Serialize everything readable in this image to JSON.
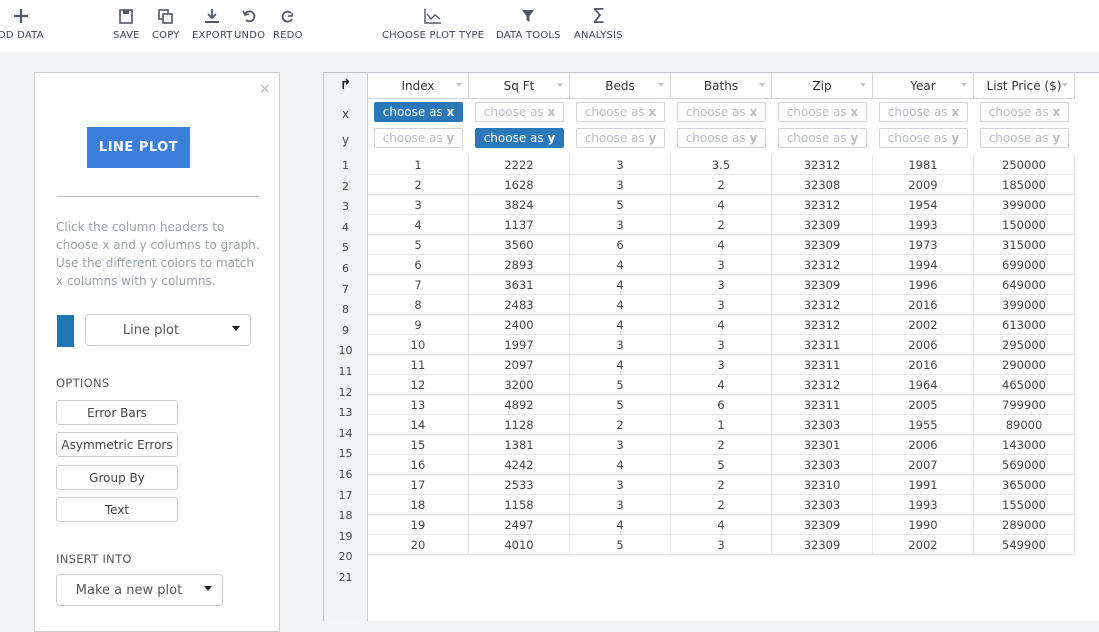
{
  "toolbar": {
    "items": [
      {
        "name": "add-data",
        "label": "DD DATA",
        "icon": "plus-icon"
      },
      {
        "name": "save",
        "label": "SAVE",
        "icon": "save-icon"
      },
      {
        "name": "copy",
        "label": "COPY",
        "icon": "copy-icon"
      },
      {
        "name": "export",
        "label": "EXPORT",
        "icon": "export-icon"
      },
      {
        "name": "undo",
        "label": "UNDO",
        "icon": "undo-icon"
      },
      {
        "name": "redo",
        "label": "REDO",
        "icon": "redo-icon"
      },
      {
        "name": "choose-plot-type",
        "label": "CHOOSE PLOT TYPE",
        "icon": "line-chart-icon"
      },
      {
        "name": "data-tools",
        "label": "DATA TOOLS",
        "icon": "filter-icon"
      },
      {
        "name": "analysis",
        "label": "ANALYSIS",
        "icon": "sigma-icon"
      }
    ]
  },
  "sidebar": {
    "close": "×",
    "plot_button": "LINE PLOT",
    "help_text": "Click the column headers to choose x and y columns to graph. Use the different colors to match x columns with y columns.",
    "swatch_color": "#1f77b4",
    "plot_type_select": "Line plot",
    "options_title": "OPTIONS",
    "options": [
      "Error Bars",
      "Asymmetric Errors",
      "Group By",
      "Text"
    ],
    "insert_title": "INSERT INTO",
    "insert_select": "Make a new plot"
  },
  "grid": {
    "corner_icon": "↱",
    "x_label": "x",
    "y_label": "y",
    "columns": [
      "Index",
      "Sq Ft",
      "Beds",
      "Baths",
      "Zip",
      "Year",
      "List Price ($)"
    ],
    "choose_prefix": "choose as ",
    "x_choice": "x",
    "y_choice": "y",
    "selected_x_column": "Index",
    "selected_y_column": "Sq Ft",
    "accent_color": "#2a78ba",
    "row_numbers": [
      "1",
      "2",
      "3",
      "4",
      "5",
      "6",
      "7",
      "8",
      "9",
      "10",
      "11",
      "12",
      "13",
      "14",
      "15",
      "16",
      "17",
      "18",
      "19",
      "20",
      "21"
    ],
    "rows": [
      [
        "1",
        "2222",
        "3",
        "3.5",
        "32312",
        "1981",
        "250000"
      ],
      [
        "2",
        "1628",
        "3",
        "2",
        "32308",
        "2009",
        "185000"
      ],
      [
        "3",
        "3824",
        "5",
        "4",
        "32312",
        "1954",
        "399000"
      ],
      [
        "4",
        "1137",
        "3",
        "2",
        "32309",
        "1993",
        "150000"
      ],
      [
        "5",
        "3560",
        "6",
        "4",
        "32309",
        "1973",
        "315000"
      ],
      [
        "6",
        "2893",
        "4",
        "3",
        "32312",
        "1994",
        "699000"
      ],
      [
        "7",
        "3631",
        "4",
        "3",
        "32309",
        "1996",
        "649000"
      ],
      [
        "8",
        "2483",
        "4",
        "3",
        "32312",
        "2016",
        "399000"
      ],
      [
        "9",
        "2400",
        "4",
        "4",
        "32312",
        "2002",
        "613000"
      ],
      [
        "10",
        "1997",
        "3",
        "3",
        "32311",
        "2006",
        "295000"
      ],
      [
        "11",
        "2097",
        "4",
        "3",
        "32311",
        "2016",
        "290000"
      ],
      [
        "12",
        "3200",
        "5",
        "4",
        "32312",
        "1964",
        "465000"
      ],
      [
        "13",
        "4892",
        "5",
        "6",
        "32311",
        "2005",
        "799900"
      ],
      [
        "14",
        "1128",
        "2",
        "1",
        "32303",
        "1955",
        "89000"
      ],
      [
        "15",
        "1381",
        "3",
        "2",
        "32301",
        "2006",
        "143000"
      ],
      [
        "16",
        "4242",
        "4",
        "5",
        "32303",
        "2007",
        "569000"
      ],
      [
        "17",
        "2533",
        "3",
        "2",
        "32310",
        "1991",
        "365000"
      ],
      [
        "18",
        "1158",
        "3",
        "2",
        "32303",
        "1993",
        "155000"
      ],
      [
        "19",
        "2497",
        "4",
        "4",
        "32309",
        "1990",
        "289000"
      ],
      [
        "20",
        "4010",
        "5",
        "3",
        "32309",
        "2002",
        "549900"
      ]
    ]
  }
}
